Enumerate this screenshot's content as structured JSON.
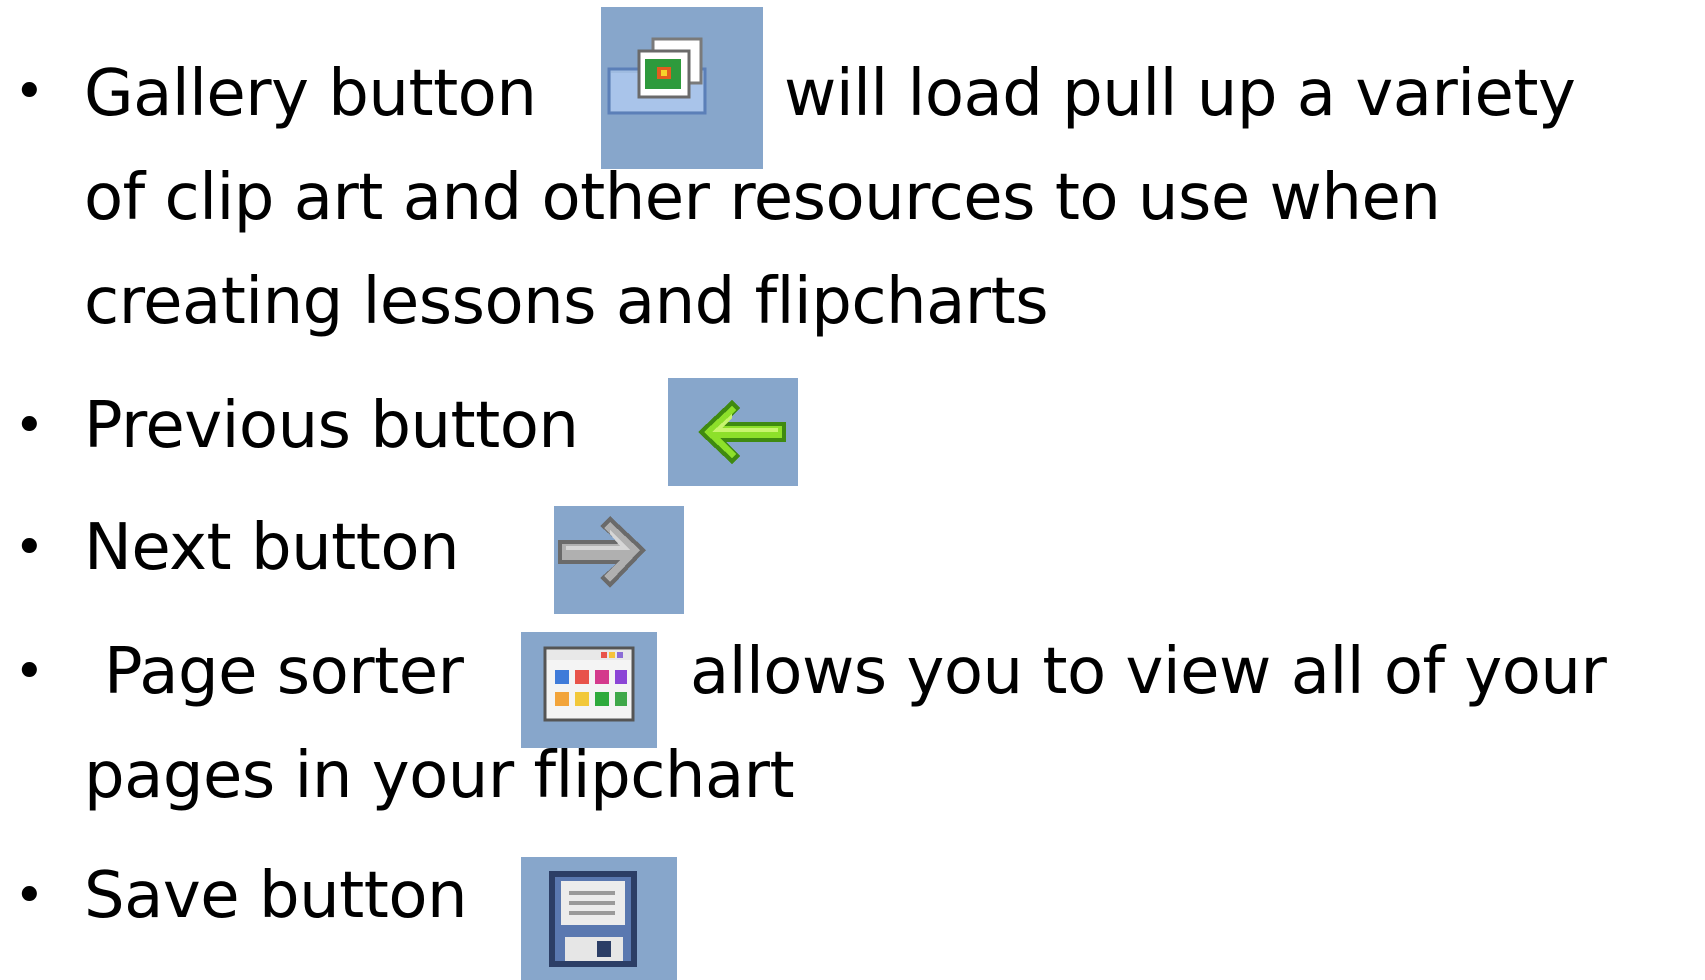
{
  "bullets": [
    {
      "icon": "gallery-icon",
      "lines": [
        "Gallery button",
        "will load pull up a variety",
        "of clip art and other resources to use when",
        "creating lessons and flipcharts"
      ]
    },
    {
      "icon": "arrow-left-icon",
      "lines": [
        "Previous button"
      ]
    },
    {
      "icon": "arrow-right-icon",
      "lines": [
        "Next button"
      ]
    },
    {
      "icon": "page-sorter-icon",
      "lines": [
        "Page sorter",
        "allows you to view all of your",
        "pages in your flipchart"
      ]
    },
    {
      "icon": "floppy-disk-icon",
      "lines": [
        "Save button"
      ]
    }
  ],
  "bullet_glyph": "•",
  "colors": {
    "icon_background": "#87a6cb",
    "previous_arrow": "#7bd81a",
    "next_arrow": "#9a9a9a",
    "text": "#000000"
  }
}
